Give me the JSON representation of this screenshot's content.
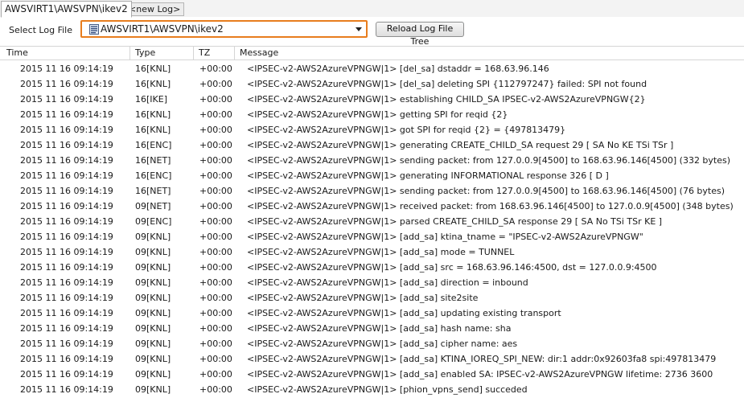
{
  "tabs": [
    {
      "label": "AWSVIRT1\\AWSVPN\\ikev2",
      "active": true
    },
    {
      "label": "<new Log>",
      "active": false
    }
  ],
  "selector": {
    "label": "Select Log File",
    "value": "AWSVIRT1\\AWSVPN\\ikev2",
    "icon": "log-file-icon",
    "reload_label": "Reload Log File Tree",
    "accent_color": "#e87d1e"
  },
  "columns": {
    "time": "Time",
    "type": "Type",
    "tz": "TZ",
    "message": "Message"
  },
  "rows": [
    {
      "time": "2015 11 16 09:14:19",
      "type": "16[KNL]",
      "tz": "+00:00",
      "message": "<IPSEC-v2-AWS2AzureVPNGW|1> [del_sa] dstaddr = 168.63.96.146"
    },
    {
      "time": "2015 11 16 09:14:19",
      "type": "16[KNL]",
      "tz": "+00:00",
      "message": "<IPSEC-v2-AWS2AzureVPNGW|1> [del_sa] deleting SPI {112797247} failed: SPI not found"
    },
    {
      "time": "2015 11 16 09:14:19",
      "type": "16[IKE]",
      "tz": "+00:00",
      "message": "<IPSEC-v2-AWS2AzureVPNGW|1> establishing CHILD_SA IPSEC-v2-AWS2AzureVPNGW{2}"
    },
    {
      "time": "2015 11 16 09:14:19",
      "type": "16[KNL]",
      "tz": "+00:00",
      "message": "<IPSEC-v2-AWS2AzureVPNGW|1> getting SPI for reqid {2}"
    },
    {
      "time": "2015 11 16 09:14:19",
      "type": "16[KNL]",
      "tz": "+00:00",
      "message": "<IPSEC-v2-AWS2AzureVPNGW|1> got SPI for reqid {2} = {497813479}"
    },
    {
      "time": "2015 11 16 09:14:19",
      "type": "16[ENC]",
      "tz": "+00:00",
      "message": "<IPSEC-v2-AWS2AzureVPNGW|1> generating CREATE_CHILD_SA request 29 [ SA No KE TSi TSr ]"
    },
    {
      "time": "2015 11 16 09:14:19",
      "type": "16[NET]",
      "tz": "+00:00",
      "message": "<IPSEC-v2-AWS2AzureVPNGW|1> sending packet: from 127.0.0.9[4500] to 168.63.96.146[4500] (332 bytes)"
    },
    {
      "time": "2015 11 16 09:14:19",
      "type": "16[ENC]",
      "tz": "+00:00",
      "message": "<IPSEC-v2-AWS2AzureVPNGW|1> generating INFORMATIONAL response 326 [ D ]"
    },
    {
      "time": "2015 11 16 09:14:19",
      "type": "16[NET]",
      "tz": "+00:00",
      "message": "<IPSEC-v2-AWS2AzureVPNGW|1> sending packet: from 127.0.0.9[4500] to 168.63.96.146[4500] (76 bytes)"
    },
    {
      "time": "2015 11 16 09:14:19",
      "type": "09[NET]",
      "tz": "+00:00",
      "message": "<IPSEC-v2-AWS2AzureVPNGW|1> received packet: from 168.63.96.146[4500] to 127.0.0.9[4500] (348 bytes)"
    },
    {
      "time": "2015 11 16 09:14:19",
      "type": "09[ENC]",
      "tz": "+00:00",
      "message": "<IPSEC-v2-AWS2AzureVPNGW|1> parsed CREATE_CHILD_SA response 29 [ SA No TSi TSr KE ]"
    },
    {
      "time": "2015 11 16 09:14:19",
      "type": "09[KNL]",
      "tz": "+00:00",
      "message": "<IPSEC-v2-AWS2AzureVPNGW|1> [add_sa] ktina_tname = \"IPSEC-v2-AWS2AzureVPNGW\""
    },
    {
      "time": "2015 11 16 09:14:19",
      "type": "09[KNL]",
      "tz": "+00:00",
      "message": "<IPSEC-v2-AWS2AzureVPNGW|1> [add_sa] mode = TUNNEL"
    },
    {
      "time": "2015 11 16 09:14:19",
      "type": "09[KNL]",
      "tz": "+00:00",
      "message": "<IPSEC-v2-AWS2AzureVPNGW|1> [add_sa] src = 168.63.96.146:4500, dst = 127.0.0.9:4500"
    },
    {
      "time": "2015 11 16 09:14:19",
      "type": "09[KNL]",
      "tz": "+00:00",
      "message": "<IPSEC-v2-AWS2AzureVPNGW|1> [add_sa] direction = inbound"
    },
    {
      "time": "2015 11 16 09:14:19",
      "type": "09[KNL]",
      "tz": "+00:00",
      "message": "<IPSEC-v2-AWS2AzureVPNGW|1> [add_sa] site2site"
    },
    {
      "time": "2015 11 16 09:14:19",
      "type": "09[KNL]",
      "tz": "+00:00",
      "message": "<IPSEC-v2-AWS2AzureVPNGW|1> [add_sa] updating existing transport"
    },
    {
      "time": "2015 11 16 09:14:19",
      "type": "09[KNL]",
      "tz": "+00:00",
      "message": "<IPSEC-v2-AWS2AzureVPNGW|1> [add_sa] hash name: sha"
    },
    {
      "time": "2015 11 16 09:14:19",
      "type": "09[KNL]",
      "tz": "+00:00",
      "message": "<IPSEC-v2-AWS2AzureVPNGW|1> [add_sa] cipher name: aes"
    },
    {
      "time": "2015 11 16 09:14:19",
      "type": "09[KNL]",
      "tz": "+00:00",
      "message": "<IPSEC-v2-AWS2AzureVPNGW|1> [add_sa] KTINA_IOREQ_SPI_NEW: dir:1 addr:0x92603fa8 spi:497813479"
    },
    {
      "time": "2015 11 16 09:14:19",
      "type": "09[KNL]",
      "tz": "+00:00",
      "message": "<IPSEC-v2-AWS2AzureVPNGW|1> [add_sa] enabled SA: IPSEC-v2-AWS2AzureVPNGW lifetime: 2736 3600"
    },
    {
      "time": "2015 11 16 09:14:19",
      "type": "09[KNL]",
      "tz": "+00:00",
      "message": "<IPSEC-v2-AWS2AzureVPNGW|1> [phion_vpns_send] succeded"
    }
  ]
}
